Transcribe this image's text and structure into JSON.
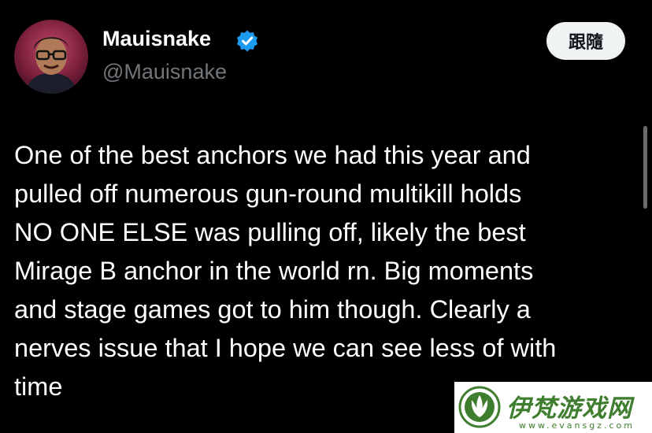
{
  "user": {
    "display_name": "Mauisnake",
    "handle": "@Mauisnake",
    "verified": true,
    "verified_color": "#1d9bf0"
  },
  "follow_button": {
    "label": "跟隨"
  },
  "tweet": {
    "lines": [
      "One of the best anchors we had this year and",
      "pulled off numerous gun-round multikill holds",
      "NO ONE ELSE was pulling off, likely the best",
      "Mirage B anchor in the world rn. Big moments",
      "and stage games got to him though. Clearly a",
      "nerves issue that I hope we can see less of with",
      "time"
    ]
  },
  "watermark": {
    "title": "伊梵游戏网",
    "url": "www.evansgz.com",
    "color": "#3f7e2f"
  },
  "icons": {
    "verified_badge": "verified-badge-icon",
    "watermark_logo": "leaf-logo-icon"
  }
}
